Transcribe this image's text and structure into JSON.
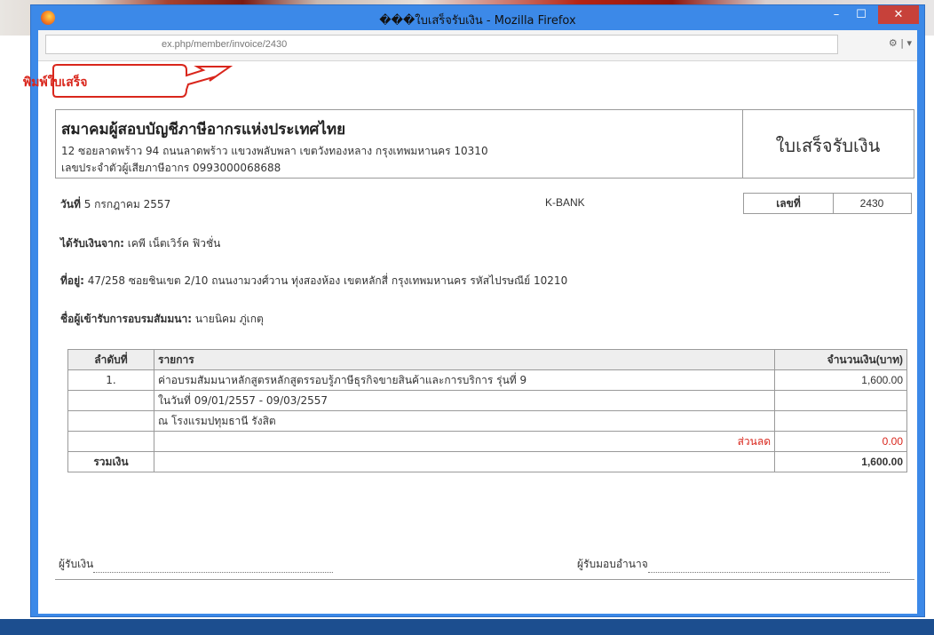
{
  "window": {
    "title": "���ใบเสร็จรับเงิน - Mozilla Firefox",
    "min_label": "–",
    "max_label": "☐",
    "close_label": "✕"
  },
  "navbar": {
    "url": "ex.php/member/invoice/2430",
    "icons": "⚙ | ▾"
  },
  "callout": {
    "text": "พิมพ์ใบเสร็จ",
    "color": "#d9261c"
  },
  "invoice": {
    "org_name": "สมาคมผู้สอบบัญชีภาษีอากรแห่งประเทศไทย",
    "org_address": "12 ซอยลาดพร้าว 94 ถนนลาดพร้าว แขวงพลับพลา เขตวังทองหลาง กรุงเทพมหานคร 10310",
    "org_tax": "เลขประจำตัวผู้เสียภาษีอากร 0993000068688",
    "doc_title": "ใบเสร็จรับเงิน",
    "date_label": "วันที่",
    "date_value": "5 กรกฎาคม 2557",
    "bank": "K-BANK",
    "no_label": "เลขที่",
    "no_value": "2430",
    "received_label": "ได้รับเงินจาก:",
    "received_value": "เคพี เน็ตเวิร์ค ฟิวชั่น",
    "address_label": "ที่อยู่:",
    "address_value": "47/258 ซอยชินเขต 2/10 ถนนงามวงศ์วาน ทุ่งสองห้อง เขตหลักสี่ กรุงเทพมหานคร รหัสไปรษณีย์ 10210",
    "attendee_label": "ชื่อผู้เข้ารับการอบรมสัมมนา:",
    "attendee_value": "นายนิคม ภู่เกตุ",
    "table": {
      "headers": [
        "ลำดับที่",
        "รายการ",
        "จำนวนเงิน(บาท)"
      ],
      "rows": [
        {
          "no": "1.",
          "item": "ค่าอบรมสัมมนาหลักสูตรหลักสูตรรอบรู้ภาษีธุรกิจขายสินค้าและการบริการ รุ่นที่ 9",
          "amount": "1,600.00"
        },
        {
          "no": "",
          "item": "ในวันที่ 09/01/2557 - 09/03/2557",
          "amount": ""
        },
        {
          "no": "",
          "item": "ณ โรงแรมปทุมธานี รังสิต",
          "amount": ""
        }
      ],
      "discount_label": "ส่วนลด",
      "discount_value": "0.00",
      "total_label": "รวมเงิน",
      "total_value": "1,600.00"
    },
    "sig_receiver": "ผู้รับเงิน",
    "sig_authorized": "ผู้รับมอบอำนาจ"
  }
}
